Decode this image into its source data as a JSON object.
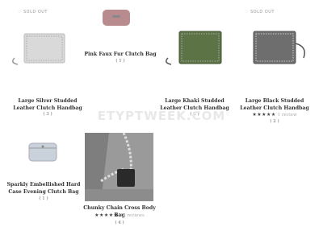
{
  "watermark": "ETYPTWEEK.COM",
  "products": [
    {
      "name": "Large Silver Studded Leather Clutch Handbag",
      "count": "( 3 )",
      "badge": "SOLD OUT",
      "color": "#c8c8c8"
    },
    {
      "name": "Pink Faux Fur Clutch Bag",
      "count": "( 1 )",
      "color": "#b88b8e"
    },
    {
      "name": "Large Khaki Studded Leather Clutch Handbag",
      "count": "( 2 )",
      "color": "#5c7346"
    },
    {
      "name": "Large Black Studded Leather Clutch Handbag",
      "count": "( 2 )",
      "badge": "SOLD OUT",
      "rating_stars": "★★★★★",
      "rating_text": "1 review",
      "color": "#6e6e6e"
    },
    {
      "name": "Sparkly Embellished Hard Case Evening Clutch Bag",
      "count": "( 1 )",
      "color": "#c9d2db"
    },
    {
      "name": "Chunky Chain Cross Body Bag",
      "count": "( 4 )",
      "rating_stars": "★★★★★",
      "rating_text": "11 reviews",
      "color": "#2a2a2a"
    }
  ]
}
